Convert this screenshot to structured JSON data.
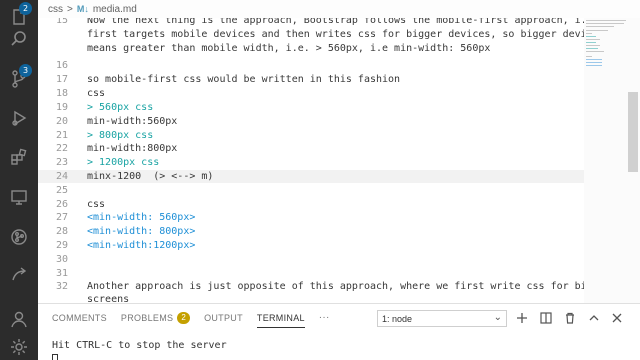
{
  "activity_bar": {
    "explorer_badge": "2",
    "source_control_badge": "3"
  },
  "breadcrumb": {
    "folder": "css",
    "separator": ">",
    "file_icon": "M↓",
    "file": "media.md"
  },
  "editor": {
    "lines": [
      {
        "num": "15",
        "text": "Now the next thing is the approach, Bootstrap follows the mobile-first approach, i.e. it"
      },
      {
        "num": "",
        "text": "first targets mobile devices and then writes css for bigger devices, so bigger devices"
      },
      {
        "num": "",
        "text": "means greater than mobile width, i.e. > 560px, i.e min-width: 560px"
      },
      {
        "num": "16",
        "text": ""
      },
      {
        "num": "17",
        "text": "so mobile-first css would be written in this fashion"
      },
      {
        "num": "18",
        "text": "css"
      },
      {
        "num": "19",
        "text": "> 560px css"
      },
      {
        "num": "20",
        "text": "min-width:560px"
      },
      {
        "num": "21",
        "text": "> 800px css"
      },
      {
        "num": "22",
        "text": "min-width:800px"
      },
      {
        "num": "23",
        "text": "> 1200px css"
      },
      {
        "num": "24",
        "text": "minx-1200  (> <--> m)"
      },
      {
        "num": "25",
        "text": ""
      },
      {
        "num": "26",
        "text": "css"
      },
      {
        "num": "27",
        "text": "<min-width: 560px>"
      },
      {
        "num": "28",
        "text": "<min-width: 800px>"
      },
      {
        "num": "29",
        "text": "<min-width:1200px>"
      },
      {
        "num": "30",
        "text": ""
      },
      {
        "num": "31",
        "text": ""
      },
      {
        "num": "32",
        "text": "Another approach is just opposite of this approach, where we first write css for bigger"
      },
      {
        "num": "",
        "text": "screens"
      }
    ]
  },
  "panel": {
    "tabs": {
      "comments": "COMMENTS",
      "problems": "PROBLEMS",
      "problems_count": "2",
      "output": "OUTPUT",
      "terminal": "TERMINAL",
      "more": "···"
    },
    "terminal_select": "1: node",
    "terminal_output": "Hit CTRL-C to stop the server"
  }
}
